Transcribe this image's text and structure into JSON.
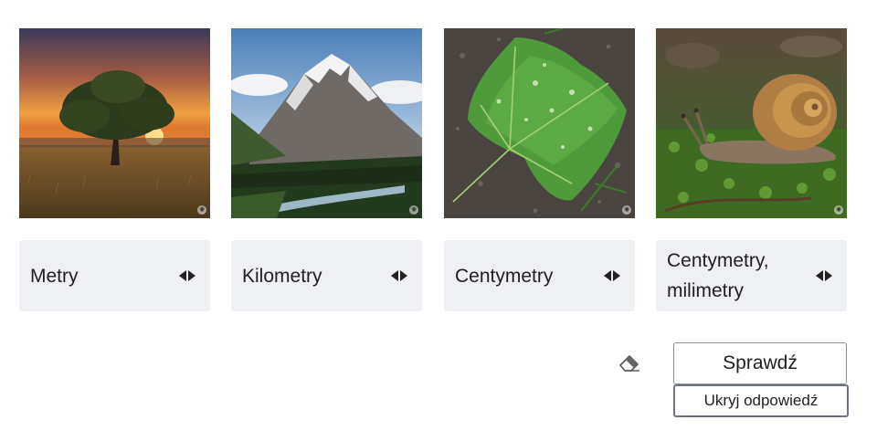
{
  "cards": [
    {
      "image_name": "tree-at-sunset",
      "answer": "Metry"
    },
    {
      "image_name": "mountain-landscape",
      "answer": "Kilometry"
    },
    {
      "image_name": "leaf-with-droplets",
      "answer": "Centymetry"
    },
    {
      "image_name": "snail-on-moss",
      "answer": "Centymetry, milimetry"
    }
  ],
  "controls": {
    "check_label": "Sprawdź",
    "hide_answer_label": "Ukryj odpowiedź"
  },
  "icons": {
    "answer_toggle": "left-right-arrows-icon",
    "reset": "eraser-icon",
    "zoom": "zoom-icon"
  }
}
